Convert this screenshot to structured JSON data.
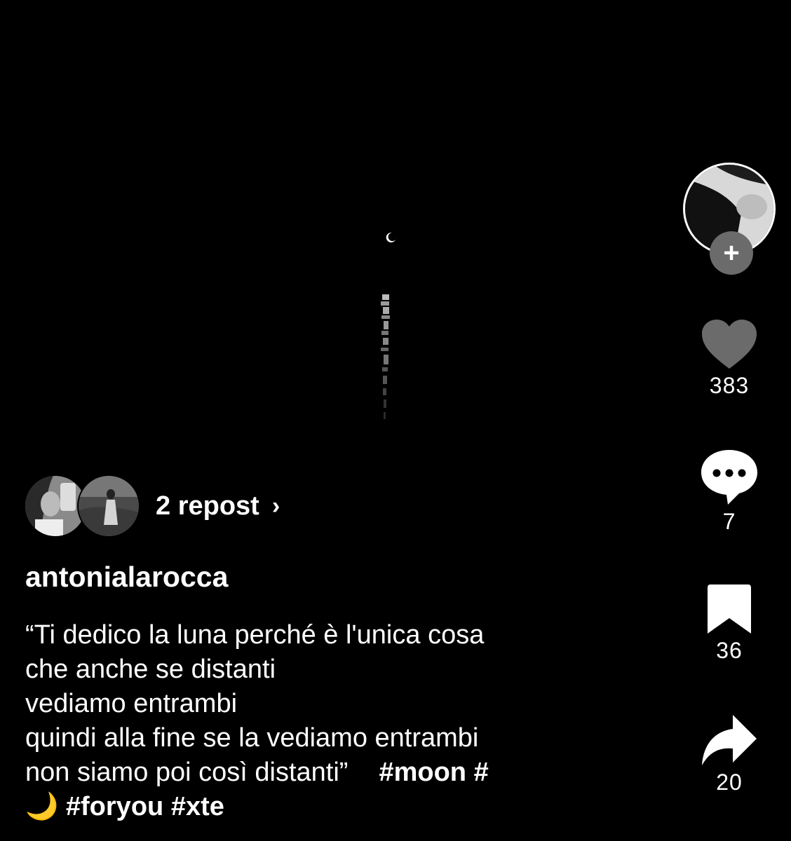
{
  "post": {
    "username": "antonialarocca",
    "caption_lines": [
      "“Ti dedico la luna perché è l'unica cosa",
      "che anche se distanti",
      "vediamo entrambi",
      "quindi alla fine se la vediamo entrambi",
      "non siamo poi così distanti”"
    ],
    "hashtags_line1": [
      "#moon",
      "#"
    ],
    "moon_emoji": "🌙",
    "hashtags_line2": [
      "#foryou",
      "#xte"
    ]
  },
  "reposts": {
    "label": "2 repost",
    "chevron": "›"
  },
  "actions": {
    "follow_symbol": "+",
    "likes": "383",
    "comments": "7",
    "saves": "36",
    "shares": "20"
  },
  "icons": {
    "like": "heart-icon",
    "comment": "comment-bubble-icon",
    "save": "bookmark-icon",
    "share": "share-arrow-icon",
    "follow": "plus-icon"
  },
  "colors": {
    "background": "#000000",
    "text": "#ffffff",
    "icon_gray": "#6b6b6b"
  }
}
